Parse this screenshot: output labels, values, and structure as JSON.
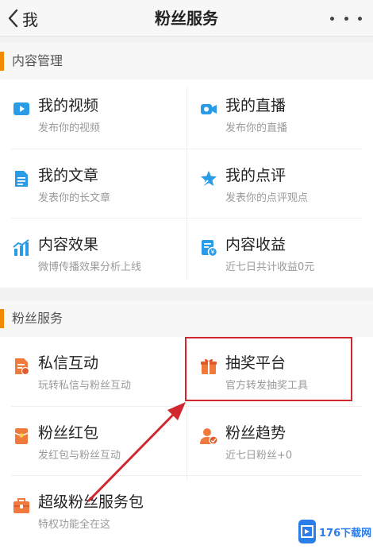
{
  "nav": {
    "back_label": "我",
    "title": "粉丝服务"
  },
  "sections": [
    {
      "title": "内容管理",
      "items": [
        {
          "title": "我的视频",
          "subtitle": "发布你的视频",
          "icon": "video-icon"
        },
        {
          "title": "我的直播",
          "subtitle": "发布你的直播",
          "icon": "live-camera-icon"
        },
        {
          "title": "我的文章",
          "subtitle": "发表你的长文章",
          "icon": "article-icon"
        },
        {
          "title": "我的点评",
          "subtitle": "发表你的点评观点",
          "icon": "review-icon"
        },
        {
          "title": "内容效果",
          "subtitle": "微博传播效果分析上线",
          "icon": "bar-chart-icon"
        },
        {
          "title": "内容收益",
          "subtitle": "近七日共计收益0元",
          "icon": "income-icon"
        }
      ]
    },
    {
      "title": "粉丝服务",
      "items": [
        {
          "title": "私信互动",
          "subtitle": "玩转私信与粉丝互动",
          "icon": "message-icon"
        },
        {
          "title": "抽奖平台",
          "subtitle": "官方转发抽奖工具",
          "icon": "gift-icon"
        },
        {
          "title": "粉丝红包",
          "subtitle": "发红包与粉丝互动",
          "icon": "red-packet-icon"
        },
        {
          "title": "粉丝趋势",
          "subtitle": "近七日粉丝+0",
          "icon": "fans-trend-icon"
        },
        {
          "title": "超级粉丝服务包",
          "subtitle": "特权功能全在这",
          "icon": "service-bag-icon"
        }
      ]
    }
  ],
  "watermark": {
    "text": "176下载网"
  },
  "colors": {
    "accent": "#f28a00",
    "highlight": "#d0282e",
    "icon_blue": "#2a9be6",
    "icon_orange": "#f07a3c"
  }
}
